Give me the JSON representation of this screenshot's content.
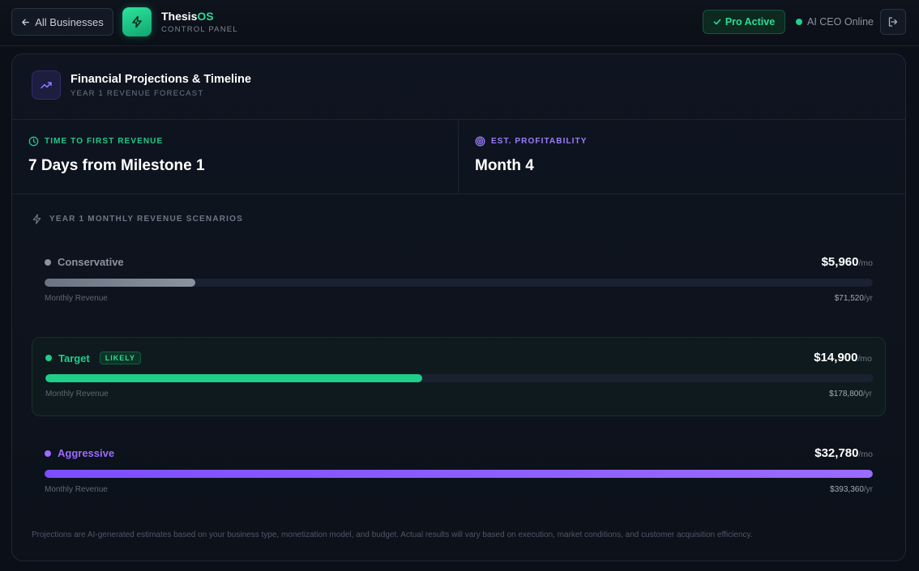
{
  "topbar": {
    "back_label": "All Businesses",
    "brand_name": "Thesis",
    "brand_suffix": "OS",
    "brand_subtitle": "CONTROL PANEL",
    "pro_label": "Pro Active",
    "ceo_status": "AI CEO Online"
  },
  "panel": {
    "title": "Financial Projections & Timeline",
    "subtitle": "YEAR 1 REVENUE FORECAST"
  },
  "stats": {
    "first_revenue_label": "TIME TO FIRST REVENUE",
    "first_revenue_value": "7 Days from Milestone 1",
    "profitability_label": "EST. PROFITABILITY",
    "profitability_value": "Month 4"
  },
  "scenarios_heading": "YEAR 1 MONTHLY REVENUE SCENARIOS",
  "scenarios": [
    {
      "name": "Conservative",
      "badge": "",
      "monthly": "$5,960",
      "monthly_unit": "/mo",
      "foot_label": "Monthly Revenue",
      "yearly": "$71,520",
      "yearly_unit": "/yr",
      "fill_fraction": 0.182,
      "color": "#8b93a1",
      "highlight": false
    },
    {
      "name": "Target",
      "badge": "LIKELY",
      "monthly": "$14,900",
      "monthly_unit": "/mo",
      "foot_label": "Monthly Revenue",
      "yearly": "$178,800",
      "yearly_unit": "/yr",
      "fill_fraction": 0.455,
      "color": "#1fce8a",
      "highlight": true
    },
    {
      "name": "Aggressive",
      "badge": "",
      "monthly": "$32,780",
      "monthly_unit": "/mo",
      "foot_label": "Monthly Revenue",
      "yearly": "$393,360",
      "yearly_unit": "/yr",
      "fill_fraction": 1.0,
      "color": "#9c6bff",
      "highlight": false
    }
  ],
  "disclaimer": "Projections are AI-generated estimates based on your business type, monetization model, and budget. Actual results will vary based on execution, market conditions, and customer acquisition efficiency.",
  "colors": {
    "accent_green": "#2ddc95",
    "accent_purple": "#9c7dff",
    "background": "#0b0f17"
  },
  "icons": {
    "back": "arrow-left-icon",
    "logo": "lightning-icon",
    "pro": "check-icon",
    "logout": "logout-icon",
    "panel": "trending-up-icon",
    "first_revenue": "clock-icon",
    "profitability": "target-icon",
    "scenarios": "lightning-icon"
  }
}
